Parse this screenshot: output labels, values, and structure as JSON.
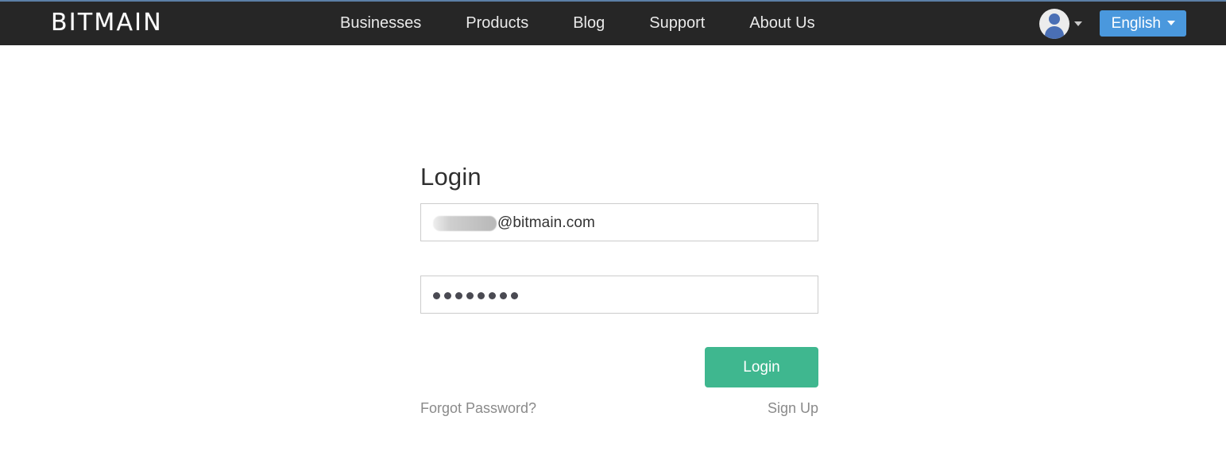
{
  "header": {
    "logo_text": "BITMAIN",
    "nav_items": [
      {
        "label": "Businesses"
      },
      {
        "label": "Products"
      },
      {
        "label": "Blog"
      },
      {
        "label": "Support"
      },
      {
        "label": "About Us"
      }
    ],
    "account": {
      "icon": "user-avatar-icon",
      "caret_icon": "chevron-down-icon"
    },
    "language": {
      "label": "English",
      "caret_icon": "chevron-down-icon"
    },
    "colors": {
      "background": "#262626",
      "nav_text": "#e9e9e9",
      "language_button": "#4a98dd",
      "top_edge": "#5b7fa6"
    }
  },
  "login": {
    "title": "Login",
    "email": {
      "value": "@bitmain.com",
      "redacted_prefix": true,
      "placeholder": "Email"
    },
    "password": {
      "value": "••••••••",
      "dot_count": 8,
      "placeholder": "Password"
    },
    "submit_label": "Login",
    "forgot_label": "Forgot Password?",
    "signup_label": "Sign Up",
    "colors": {
      "submit_button": "#3fb78f",
      "field_border": "#cccccc",
      "link_text": "#8a8a8a",
      "title_text": "#2f2f2f"
    }
  }
}
